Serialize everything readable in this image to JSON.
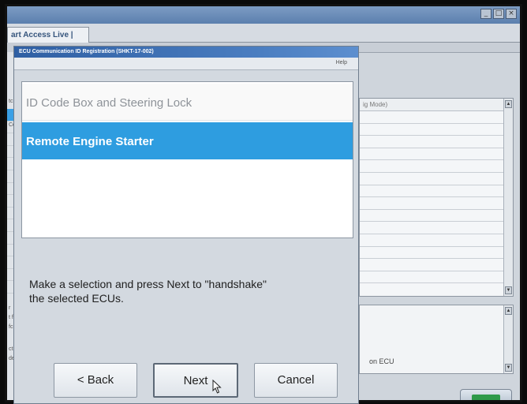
{
  "background": {
    "tab_label": "art Access Live |",
    "list_header": "ig Mode)",
    "note_text": "on ECU",
    "window_controls": [
      "_",
      "□",
      "×"
    ],
    "left_column_text": [
      "tc",
      "Cod"
    ],
    "left_lower_text": [
      "r",
      "t fu",
      "fc",
      "cti",
      "de"
    ]
  },
  "dialog": {
    "title": "ECU Communication ID Registration (SHKT-17-002)",
    "help_label": "Help",
    "items": [
      {
        "label": "ID Code Box and Steering Lock",
        "selected": false
      },
      {
        "label": "Remote Engine Starter",
        "selected": true
      }
    ],
    "instruction_line1": "Make a selection and press Next to \"handshake\"",
    "instruction_line2": "the selected ECUs.",
    "buttons": {
      "back": "< Back",
      "next": "Next",
      "cancel": "Cancel"
    }
  },
  "colors": {
    "selection": "#2e9de0",
    "title_bar": "#2f5fa3"
  }
}
